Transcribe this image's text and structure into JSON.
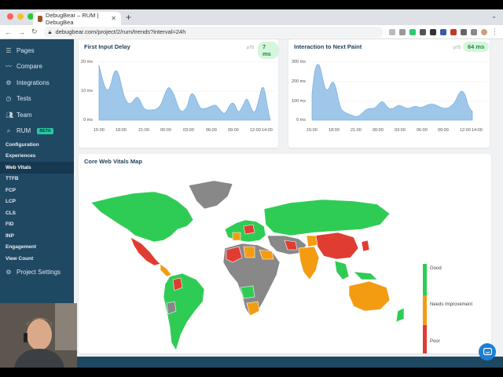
{
  "browser": {
    "tab_title": "DebugBear – RUM | DebugBea",
    "url": "debugbear.com/project/2/rum/trends?interval=24h"
  },
  "sidebar": {
    "items": [
      {
        "label": "Pages",
        "icon": "list-icon"
      },
      {
        "label": "Compare",
        "icon": "chart-line-icon"
      },
      {
        "label": "Integrations",
        "icon": "gear-icon"
      },
      {
        "label": "Tests",
        "icon": "clock-icon"
      },
      {
        "label": "Team",
        "icon": "users-icon"
      }
    ],
    "rum": {
      "label": "RUM",
      "badge": "BETA"
    },
    "sub_items": [
      "Configuration",
      "Experiences",
      "Web Vitals",
      "TTFB",
      "FCP",
      "LCP",
      "CLS",
      "FID",
      "INP",
      "Engagement",
      "View Count"
    ],
    "active_sub": "Web Vitals",
    "settings": "Project Settings"
  },
  "fid": {
    "title": "First Input Delay",
    "p75_label": "p75",
    "value": "7 ms",
    "y_ticks": [
      "20 ms",
      "10 ms",
      "0 ms"
    ],
    "x_ticks": [
      "15:00",
      "18:00",
      "21:00",
      "00:00",
      "03:00",
      "06:00",
      "09:00",
      "12:00",
      "14:00"
    ]
  },
  "inp": {
    "title": "Interaction to Next Paint",
    "p75_label": "p75",
    "value": "64 ms",
    "y_ticks": [
      "300 ms",
      "200 ms",
      "100 ms",
      "0 ms"
    ],
    "x_ticks": [
      "15:00",
      "18:00",
      "21:00",
      "00:00",
      "03:00",
      "06:00",
      "09:00",
      "12:00",
      "14:00"
    ]
  },
  "map": {
    "title": "Core Web Vitals Map",
    "legend": [
      "Good",
      "Needs Improvement",
      "Poor"
    ],
    "colors": {
      "good": "#2ecc55",
      "needs_improvement": "#f39c12",
      "poor": "#e03c31",
      "no_data": "#888888"
    }
  }
}
